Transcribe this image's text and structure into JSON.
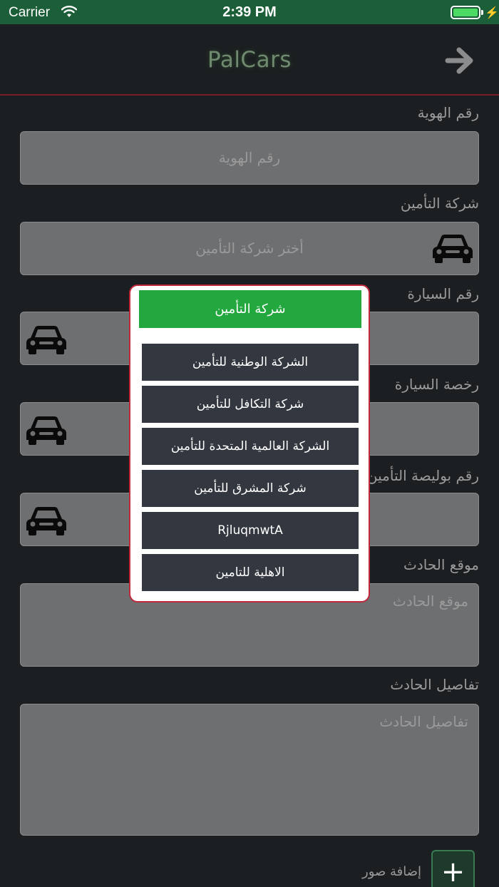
{
  "status_bar": {
    "carrier": "Carrier",
    "time": "2:39 PM",
    "wifi_icon": "wifi-icon",
    "battery_icon": "battery-icon",
    "battery_level": 1.0,
    "charging_icon": "bolt-icon"
  },
  "nav": {
    "title": "PalCars",
    "back_icon": "arrow-right-icon"
  },
  "form": {
    "id_label": "رقم الهوية",
    "id_placeholder": "رقم الهوية",
    "insurance_label": "شركة التأمين",
    "insurance_placeholder": "أختر شركة التأمين",
    "car_number_label": "رقم السيارة",
    "car_license_label": "رخصة السيارة",
    "policy_label": "رقم بوليصة التأمين",
    "accident_location_label": "موقع الحادث",
    "accident_location_placeholder": "موقع الحادث",
    "accident_details_label": "تفاصيل الحادث",
    "accident_details_placeholder": "تفاصيل الحادث",
    "add_photos_label": "إضافة صور",
    "add_button": "+",
    "car_icon": "car-icon"
  },
  "popup": {
    "title": "شركة التأمين",
    "options": [
      "الشركة الوطنية للتأمين",
      "شركة التكافل للتأمين",
      "الشركة العالمية المتحدة للتأمين",
      "شركة المشرق للتأمين",
      "RjluqmwtA",
      "الاهلية للتامين"
    ]
  },
  "colors": {
    "status_bar": "#1b5e38",
    "background": "#1c1f21",
    "field": "#6e6f71",
    "accent_green": "#22a83e",
    "popup_border": "#c0283c",
    "option_bg": "#33373f"
  }
}
